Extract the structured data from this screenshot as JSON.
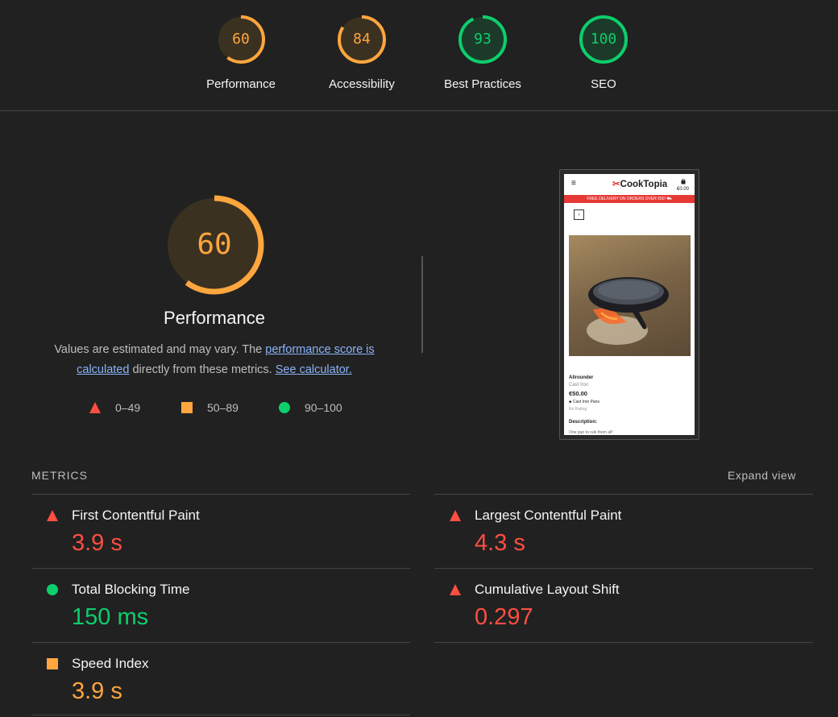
{
  "scores": [
    {
      "value": "60",
      "label": "Performance",
      "score": 0.6,
      "color": "#ffa63e"
    },
    {
      "value": "84",
      "label": "Accessibility",
      "score": 0.84,
      "color": "#ffa63e"
    },
    {
      "value": "93",
      "label": "Best Practices",
      "score": 0.93,
      "color": "#0cce6b"
    },
    {
      "value": "100",
      "label": "SEO",
      "score": 1.0,
      "color": "#0cce6b"
    }
  ],
  "performance": {
    "score_value": "60",
    "score": 0.6,
    "title": "Performance",
    "desc_prefix": "Values are estimated and may vary. The ",
    "desc_link1": "performance score is calculated",
    "desc_middle": " directly from these metrics. ",
    "desc_link2": "See calculator."
  },
  "legend": [
    {
      "range": "0–49",
      "shape": "triangle",
      "color": "#ff4e42"
    },
    {
      "range": "50–89",
      "shape": "square",
      "color": "#ffa63e"
    },
    {
      "range": "90–100",
      "shape": "circle",
      "color": "#0cce6b"
    }
  ],
  "screenshot": {
    "menu_icon": "≡",
    "logo_mark": "✂",
    "logo_text": "CookTopia",
    "cart_icon": "bag-icon",
    "cart_total": "€0.00",
    "banner": "FREE DELIVERY ON ORDERS OVER €50! ⛟",
    "back_icon": "‹",
    "product_name": "Allrounder",
    "product_category": "Cast Iron",
    "product_price": "€50.00",
    "product_tag": "⬥ Cast Iron Pans",
    "product_rating": "No Rating",
    "description_heading": "Description:",
    "description_text": "One pan to rule them all!"
  },
  "metrics_section": {
    "label": "METRICS",
    "expand": "Expand view"
  },
  "metrics": [
    {
      "name": "First Contentful Paint",
      "value": "3.9 s",
      "status": "triangle",
      "color": "#ff4e42"
    },
    {
      "name": "Largest Contentful Paint",
      "value": "4.3 s",
      "status": "triangle",
      "color": "#ff4e42"
    },
    {
      "name": "Total Blocking Time",
      "value": "150 ms",
      "status": "circle",
      "color": "#0cce6b"
    },
    {
      "name": "Cumulative Layout Shift",
      "value": "0.297",
      "status": "triangle",
      "color": "#ff4e42"
    },
    {
      "name": "Speed Index",
      "value": "3.9 s",
      "status": "square",
      "color": "#ffa63e"
    }
  ]
}
